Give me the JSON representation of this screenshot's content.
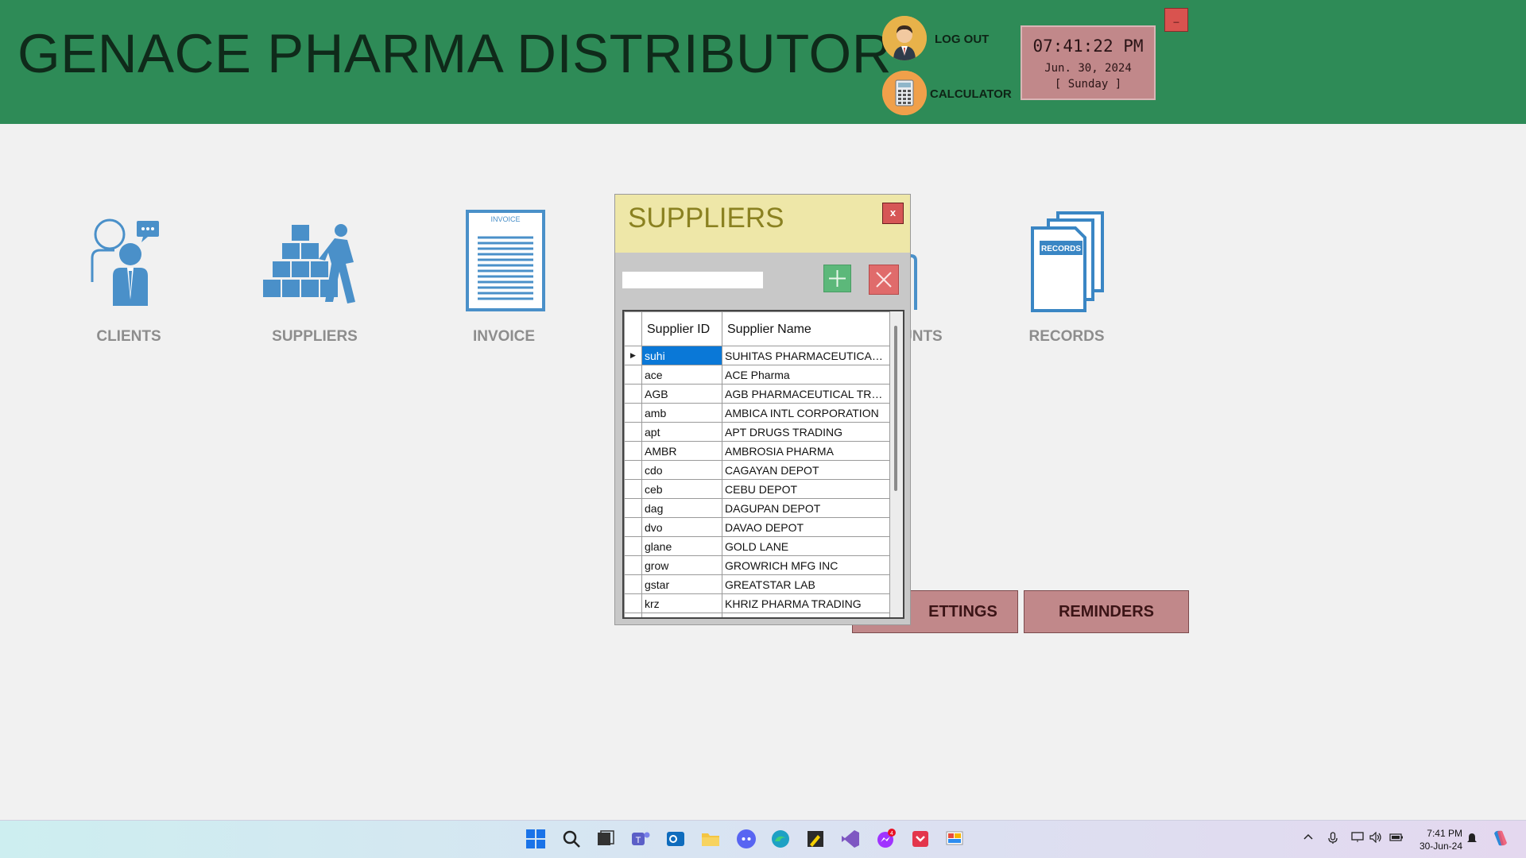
{
  "header": {
    "title": "GENACE PHARMA DISTRIBUTOR",
    "logout_label": "LOG OUT",
    "calculator_label": "CALCULATOR",
    "clock_time": "07:41:22 PM",
    "clock_date": "Jun. 30, 2024",
    "clock_day": "[ Sunday ]",
    "minimize_label": "_"
  },
  "modules": [
    {
      "label": "CLIENTS",
      "icon": "clients-icon"
    },
    {
      "label": "SUPPLIERS",
      "icon": "suppliers-icon"
    },
    {
      "label": "INVOICE",
      "icon": "invoice-icon"
    },
    {
      "label": "UNTS",
      "icon": "accounts-icon"
    },
    {
      "label": "RECORDS",
      "icon": "records-icon"
    }
  ],
  "invoice_icon_text": "INVOICE",
  "records_icon_text": "RECORDS",
  "buttons": {
    "settings_label": "ETTINGS",
    "reminders_label": "REMINDERS"
  },
  "suppliers_dialog": {
    "title": "SUPPLIERS",
    "close_label": "x",
    "search_value": "",
    "columns": [
      "Supplier ID",
      "Supplier Name"
    ],
    "rows": [
      {
        "id": "suhi",
        "name": "SUHITAS PHARMACEUTICAL..."
      },
      {
        "id": "ace",
        "name": "ACE Pharma"
      },
      {
        "id": "AGB",
        "name": "AGB PHARMACEUTICAL TRA..."
      },
      {
        "id": "amb",
        "name": "AMBICA INTL CORPORATION"
      },
      {
        "id": "apt",
        "name": "APT DRUGS TRADING"
      },
      {
        "id": "AMBR",
        "name": "AMBROSIA PHARMA"
      },
      {
        "id": "cdo",
        "name": "CAGAYAN DEPOT"
      },
      {
        "id": "ceb",
        "name": "CEBU DEPOT"
      },
      {
        "id": "dag",
        "name": "DAGUPAN DEPOT"
      },
      {
        "id": "dvo",
        "name": "DAVAO DEPOT"
      },
      {
        "id": "glane",
        "name": "GOLD LANE"
      },
      {
        "id": "grow",
        "name": "GROWRICH MFG INC"
      },
      {
        "id": "gstar",
        "name": "GREATSTAR LAB"
      },
      {
        "id": "krz",
        "name": "KHRIZ PHARMA TRADING"
      }
    ],
    "selected_row": 0
  },
  "taskbar": {
    "time": "7:41 PM",
    "date": "30-Jun-24",
    "messenger_badge": "4"
  },
  "colors": {
    "header_bg": "#2e8b57",
    "accent_button": "#c1888a",
    "dialog_header": "#eee7a8",
    "selection": "#0a78d7"
  }
}
